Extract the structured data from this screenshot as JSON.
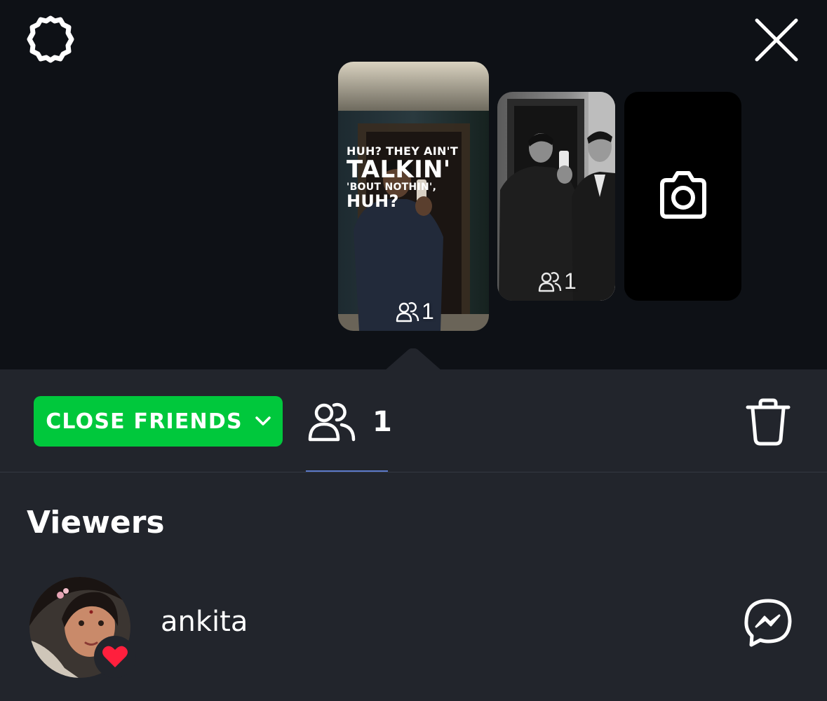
{
  "header": {
    "settings_icon": "gear-icon",
    "close_icon": "close-icon"
  },
  "stories": [
    {
      "caption": [
        "HUH? THEY AIN'T",
        "TALKIN'",
        "'BOUT NOTHIN',",
        "HUH?"
      ],
      "viewer_count": "1",
      "selected": true
    },
    {
      "viewer_count": "1",
      "selected": false
    },
    {
      "type": "add-story",
      "icon": "camera-icon"
    }
  ],
  "toolbar": {
    "audience_label": "CLOSE FRIENDS",
    "audience_color": "#00c83c",
    "viewers_count": "1",
    "delete_icon": "trash-icon"
  },
  "viewers_section": {
    "title": "Viewers",
    "viewers": [
      {
        "name": "ankita",
        "reaction": "heart",
        "reaction_color": "#ff1f3d",
        "action_icon": "messenger-icon"
      }
    ]
  }
}
